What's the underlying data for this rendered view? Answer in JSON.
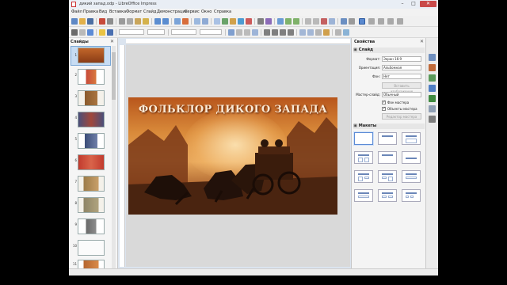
{
  "window": {
    "title": "дикий запад.odp - LibreOffice Impress",
    "min_icon": "–",
    "max_icon": "□",
    "close_icon": "✕"
  },
  "menu": [
    "Файл",
    "Правка",
    "Вид",
    "Вставка",
    "Формат",
    "Слайд",
    "Демонстрация",
    "Сервис",
    "Окно",
    "Справка"
  ],
  "slides_pane": {
    "title": "Слайды",
    "close_icon": "✕",
    "slide_numbers": [
      "1",
      "2",
      "3",
      "4",
      "5",
      "6",
      "7",
      "8",
      "9",
      "10",
      "11"
    ]
  },
  "slide": {
    "title": "ФОЛЬКЛОР ДИКОГО ЗАПАДА"
  },
  "properties": {
    "header": "Свойства",
    "close_icon": "✕",
    "slide_section": "Слайд",
    "format_label": "Формат:",
    "format_value": "Экран 16:9",
    "orientation_label": "Ориентация:",
    "orientation_value": "Альбомная",
    "background_label": "Фон:",
    "background_value": "Нет",
    "insert_image_button": "Вставить изображение",
    "master_label": "Мастер-слайд:",
    "master_value": "Обычный",
    "master_background_label": "Фон мастера",
    "master_objects_label": "Объекты мастера",
    "edit_master_button": "Редактор мастера",
    "layouts_section": "Макеты",
    "expand_icon": "▣"
  },
  "colors": {
    "accent": "#5c8bd6",
    "close_button": "#c94a4a"
  }
}
